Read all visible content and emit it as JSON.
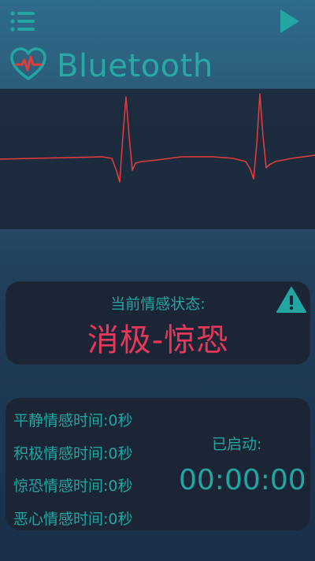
{
  "header": {
    "title": "Bluetooth",
    "menu_icon": "menu-icon",
    "play_icon": "play-icon",
    "logo_icon": "heart-pulse-icon"
  },
  "emotion": {
    "label": "当前情感状态:",
    "value": "消极-惊恐",
    "warning_icon": "warning-icon"
  },
  "stats": {
    "items": [
      "平静情感时间:0秒",
      "积极情感时间:0秒",
      "惊恐情感时间:0秒",
      "恶心情感时间:0秒"
    ],
    "status": "已启动:",
    "timer": "00:00:00"
  },
  "colors": {
    "accent": "#22a6a2",
    "alert": "#e8385a",
    "ecg_line": "#e23b3b"
  }
}
